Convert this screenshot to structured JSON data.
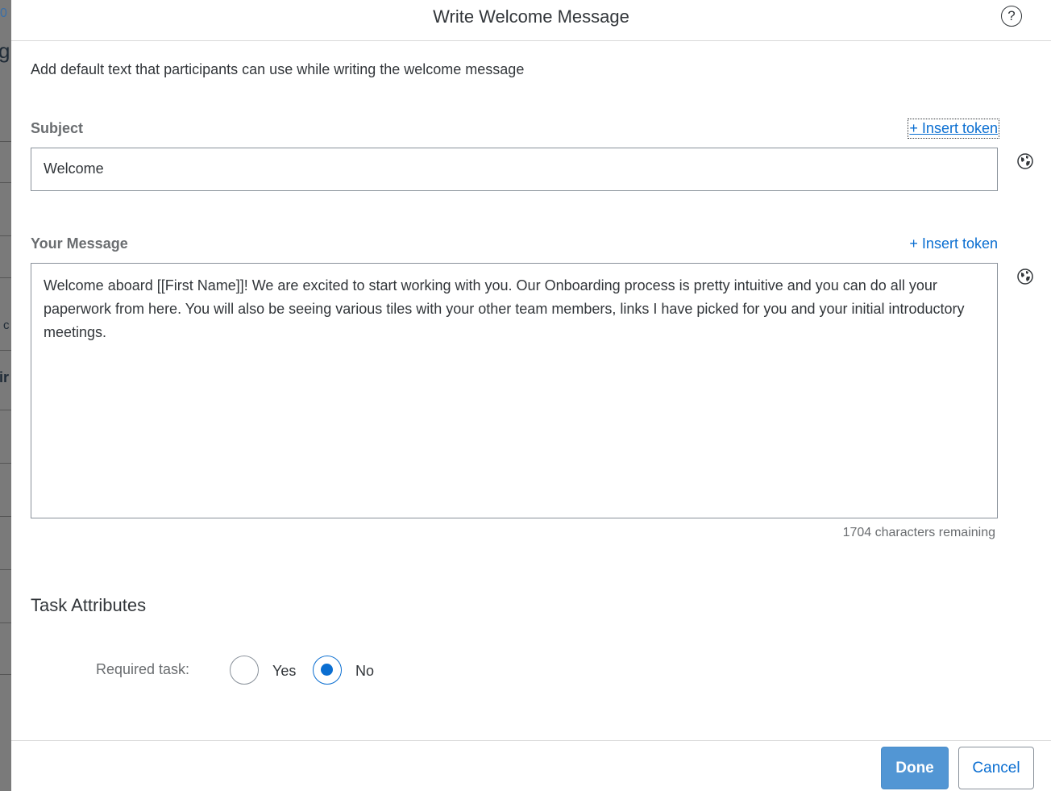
{
  "background": {
    "fragments": [
      "0",
      "g",
      "c",
      "ir"
    ]
  },
  "dialog": {
    "title": "Write Welcome Message",
    "help_icon": "question-mark-icon",
    "intro": "Add default text that participants can use while writing the welcome message"
  },
  "subject": {
    "label": "Subject",
    "insert_token": "+ Insert token",
    "value": "Welcome",
    "translate_icon": "globe-icon"
  },
  "message": {
    "label": "Your Message",
    "insert_token": "+ Insert token",
    "value": "Welcome aboard [[First Name]]! We are excited to start working with you. Our Onboarding process is pretty intuitive and you can do all your paperwork from here. You will also be seeing various tiles with your other team members, links I have picked for you and your initial introductory meetings.",
    "chars_remaining": "1704 characters remaining",
    "translate_icon": "globe-icon"
  },
  "task_attributes": {
    "title": "Task Attributes",
    "required_label": "Required task:",
    "options": [
      {
        "label": "Yes",
        "selected": false
      },
      {
        "label": "No",
        "selected": true
      }
    ]
  },
  "footer": {
    "done": "Done",
    "cancel": "Cancel"
  },
  "colors": {
    "accent": "#0a6ed1",
    "primary_button": "#5296d4",
    "border": "#89919a",
    "label_gray": "#6a6d70"
  }
}
